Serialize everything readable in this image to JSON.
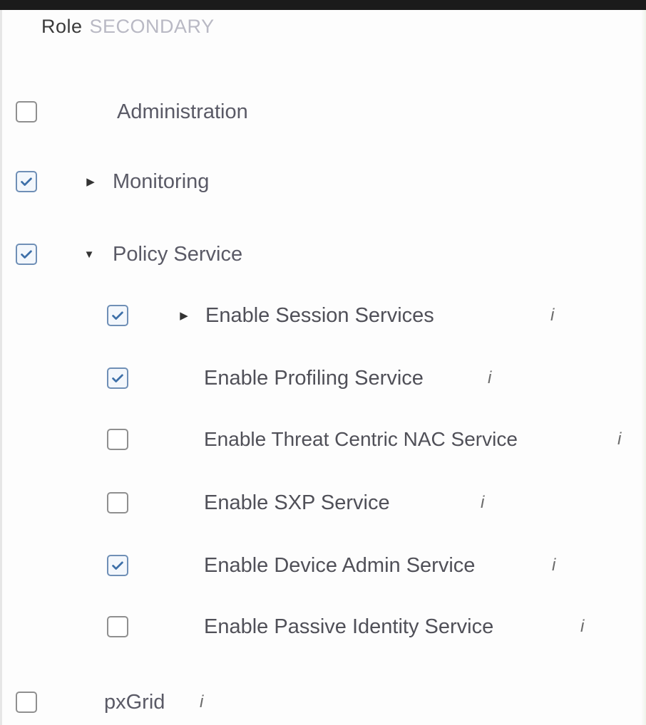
{
  "header": {
    "title": "Role",
    "title_suffix": "SECONDARY"
  },
  "roles": [
    {
      "label": "Administration",
      "checked": false,
      "expandable": false
    },
    {
      "label": "Monitoring",
      "checked": true,
      "expandable": true,
      "expanded": false
    },
    {
      "label": "Policy Service",
      "checked": true,
      "expandable": true,
      "expanded": true
    }
  ],
  "policy_services": [
    {
      "label": "Enable Session Services",
      "checked": true,
      "expandable": true,
      "info": "i"
    },
    {
      "label": "Enable Profiling Service",
      "checked": true,
      "expandable": false,
      "info": "i"
    },
    {
      "label": "Enable Threat Centric NAC Service",
      "checked": false,
      "expandable": false,
      "info": "i"
    },
    {
      "label": "Enable SXP Service",
      "checked": false,
      "expandable": false,
      "info": "i"
    },
    {
      "label": "Enable Device Admin Service",
      "checked": true,
      "expandable": false,
      "info": "i"
    },
    {
      "label": "Enable Passive Identity Service",
      "checked": false,
      "expandable": false,
      "info": "i"
    }
  ],
  "bottom_item": {
    "label": "pxGrid",
    "checked": false,
    "info": "i"
  },
  "colors": {
    "checkbox_checked_border": "#6f8fb6",
    "checkmark": "#3d6fa8",
    "text": "#505058"
  },
  "icons": {
    "checked": "check-icon",
    "expand_collapsed": "caret-right-icon",
    "expand_open": "caret-down-icon",
    "info": "info-icon"
  }
}
